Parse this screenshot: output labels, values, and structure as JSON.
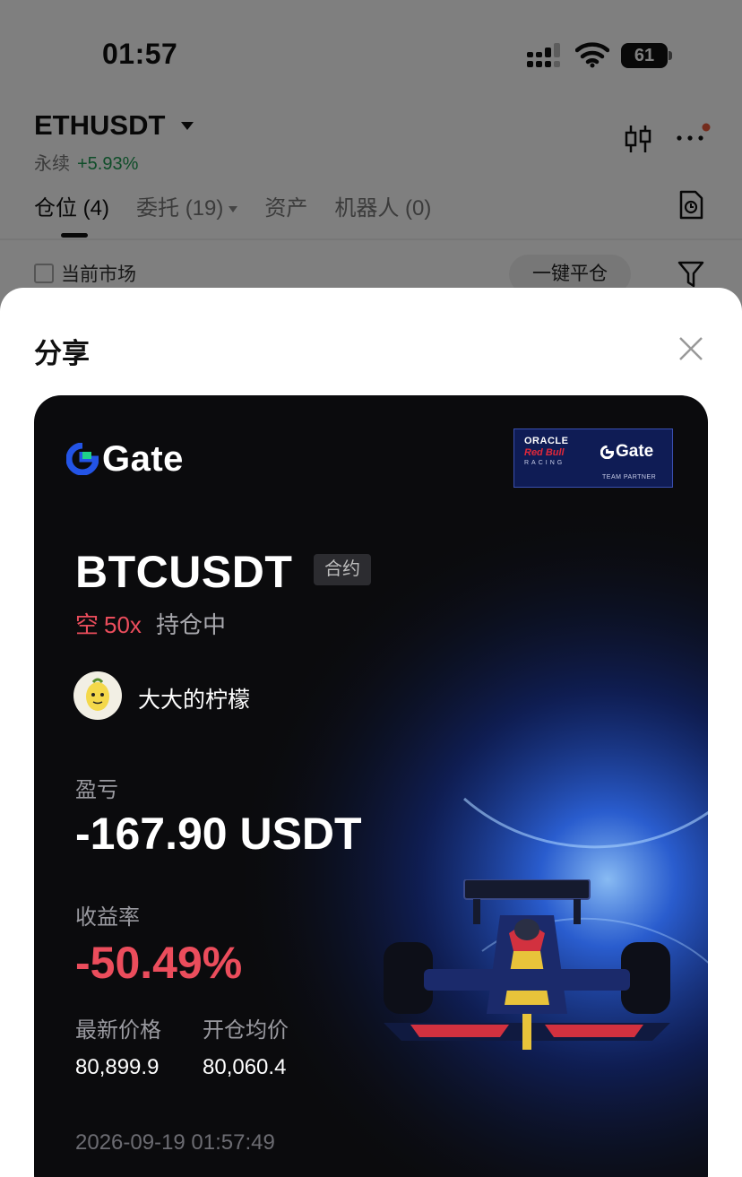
{
  "status_bar": {
    "time": "01:57",
    "battery": "61"
  },
  "header": {
    "pair": "ETHUSDT",
    "type": "永续",
    "change": "+5.93%"
  },
  "tabs": [
    {
      "label": "仓位",
      "count": "(4)"
    },
    {
      "label": "委托",
      "count": "(19)"
    },
    {
      "label": "资产",
      "count": ""
    },
    {
      "label": "机器人",
      "count": "(0)"
    }
  ],
  "filter": {
    "current_market": "当前市场",
    "close_all": "一键平仓"
  },
  "share": {
    "title": "分享",
    "brand": "Gate",
    "partner": {
      "oracle": "ORACLE",
      "redbull": "Red Bull",
      "racing": "RACING",
      "gate": "Gate",
      "team_partner": "TEAM PARTNER"
    },
    "symbol": "BTCUSDT",
    "contract_badge": "合约",
    "direction": "空",
    "leverage": "50x",
    "status": "持仓中",
    "username": "大大的柠檬",
    "pnl_label": "盈亏",
    "pnl_value": "-167.90 USDT",
    "roi_label": "收益率",
    "roi_value": "-50.49%",
    "last_price_label": "最新价格",
    "last_price": "80,899.9",
    "entry_price_label": "开仓均价",
    "entry_price": "80,060.4",
    "timestamp": "2026-09-19 01:57:49"
  },
  "colors": {
    "loss": "#eb4d5c",
    "gain": "#1f9a52",
    "brand_blue": "#2354e6",
    "card_bg": "#0b0b0d"
  },
  "icons": [
    "signal-icon",
    "wifi-icon",
    "battery-icon",
    "caret-down-icon",
    "candlestick-icon",
    "more-icon",
    "history-icon",
    "filter-icon",
    "close-icon",
    "gate-logo-icon",
    "f1-car-image"
  ]
}
